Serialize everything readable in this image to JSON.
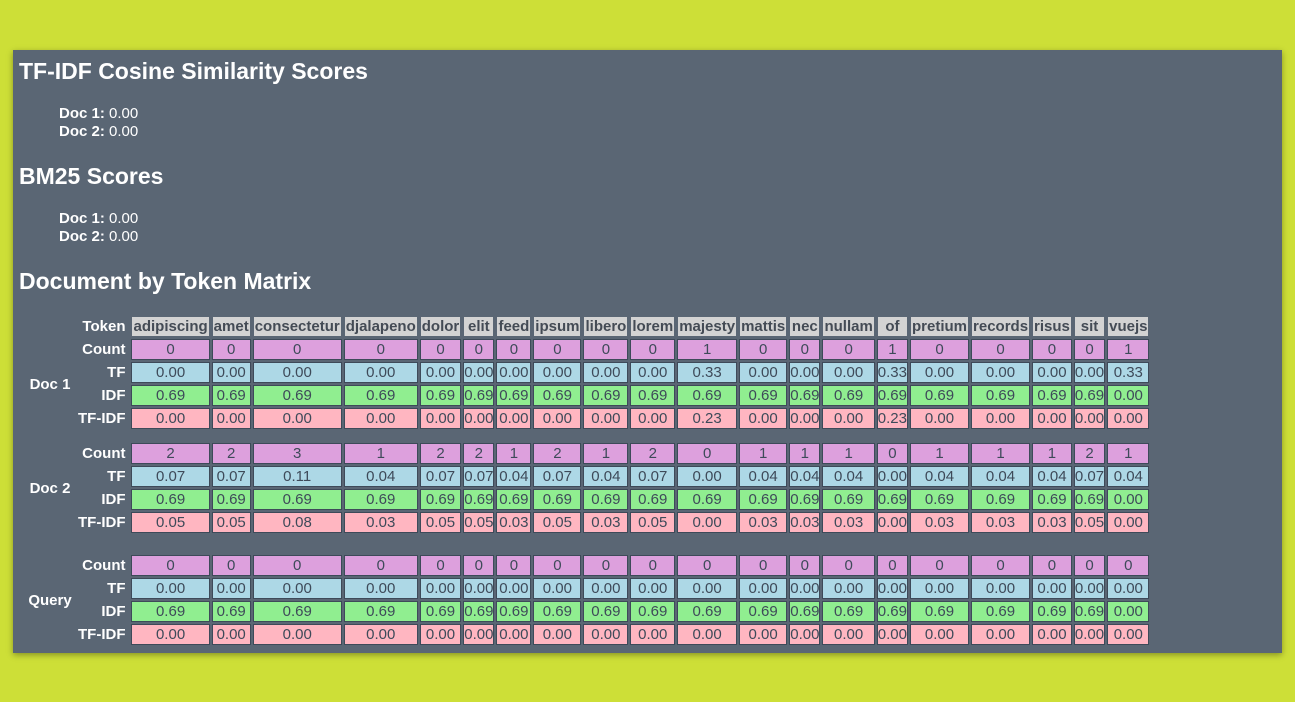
{
  "titles": {
    "cosine": "TF-IDF Cosine Similarity Scores",
    "bm25": "BM25 Scores",
    "matrix": "Document by Token Matrix"
  },
  "cosine_scores": [
    {
      "label": "Doc 1:",
      "value": "0.00"
    },
    {
      "label": "Doc 2:",
      "value": "0.00"
    }
  ],
  "bm25_scores": [
    {
      "label": "Doc 1:",
      "value": "0.00"
    },
    {
      "label": "Doc 2:",
      "value": "0.00"
    }
  ],
  "token_label": "Token",
  "tokens": [
    "adipiscing",
    "amet",
    "consectetur",
    "djalapeno",
    "dolor",
    "elit",
    "feed",
    "ipsum",
    "libero",
    "lorem",
    "majesty",
    "mattis",
    "nec",
    "nullam",
    "of",
    "pretium",
    "records",
    "risus",
    "sit",
    "vuejs"
  ],
  "row_labels": {
    "count": "Count",
    "tf": "TF",
    "idf": "IDF",
    "tfidf": "TF-IDF"
  },
  "colors": {
    "count": "#dda0dd",
    "tf": "#add8e6",
    "idf": "#90ee90",
    "tfidf": "#ffb6c1",
    "panel": "#5a6674",
    "background": "#cddf37"
  },
  "groups": [
    {
      "label": "Doc 1",
      "count": [
        "0",
        "0",
        "0",
        "0",
        "0",
        "0",
        "0",
        "0",
        "0",
        "0",
        "1",
        "0",
        "0",
        "0",
        "1",
        "0",
        "0",
        "0",
        "0",
        "1"
      ],
      "tf": [
        "0.00",
        "0.00",
        "0.00",
        "0.00",
        "0.00",
        "0.00",
        "0.00",
        "0.00",
        "0.00",
        "0.00",
        "0.33",
        "0.00",
        "0.00",
        "0.00",
        "0.33",
        "0.00",
        "0.00",
        "0.00",
        "0.00",
        "0.33"
      ],
      "idf": [
        "0.69",
        "0.69",
        "0.69",
        "0.69",
        "0.69",
        "0.69",
        "0.69",
        "0.69",
        "0.69",
        "0.69",
        "0.69",
        "0.69",
        "0.69",
        "0.69",
        "0.69",
        "0.69",
        "0.69",
        "0.69",
        "0.69",
        "0.00"
      ],
      "tfidf": [
        "0.00",
        "0.00",
        "0.00",
        "0.00",
        "0.00",
        "0.00",
        "0.00",
        "0.00",
        "0.00",
        "0.00",
        "0.23",
        "0.00",
        "0.00",
        "0.00",
        "0.23",
        "0.00",
        "0.00",
        "0.00",
        "0.00",
        "0.00"
      ]
    },
    {
      "label": "Doc 2",
      "count": [
        "2",
        "2",
        "3",
        "1",
        "2",
        "2",
        "1",
        "2",
        "1",
        "2",
        "0",
        "1",
        "1",
        "1",
        "0",
        "1",
        "1",
        "1",
        "2",
        "1"
      ],
      "tf": [
        "0.07",
        "0.07",
        "0.11",
        "0.04",
        "0.07",
        "0.07",
        "0.04",
        "0.07",
        "0.04",
        "0.07",
        "0.00",
        "0.04",
        "0.04",
        "0.04",
        "0.00",
        "0.04",
        "0.04",
        "0.04",
        "0.07",
        "0.04"
      ],
      "idf": [
        "0.69",
        "0.69",
        "0.69",
        "0.69",
        "0.69",
        "0.69",
        "0.69",
        "0.69",
        "0.69",
        "0.69",
        "0.69",
        "0.69",
        "0.69",
        "0.69",
        "0.69",
        "0.69",
        "0.69",
        "0.69",
        "0.69",
        "0.00"
      ],
      "tfidf": [
        "0.05",
        "0.05",
        "0.08",
        "0.03",
        "0.05",
        "0.05",
        "0.03",
        "0.05",
        "0.03",
        "0.05",
        "0.00",
        "0.03",
        "0.03",
        "0.03",
        "0.00",
        "0.03",
        "0.03",
        "0.03",
        "0.05",
        "0.00"
      ]
    },
    {
      "label": "Query",
      "count": [
        "0",
        "0",
        "0",
        "0",
        "0",
        "0",
        "0",
        "0",
        "0",
        "0",
        "0",
        "0",
        "0",
        "0",
        "0",
        "0",
        "0",
        "0",
        "0",
        "0"
      ],
      "tf": [
        "0.00",
        "0.00",
        "0.00",
        "0.00",
        "0.00",
        "0.00",
        "0.00",
        "0.00",
        "0.00",
        "0.00",
        "0.00",
        "0.00",
        "0.00",
        "0.00",
        "0.00",
        "0.00",
        "0.00",
        "0.00",
        "0.00",
        "0.00"
      ],
      "idf": [
        "0.69",
        "0.69",
        "0.69",
        "0.69",
        "0.69",
        "0.69",
        "0.69",
        "0.69",
        "0.69",
        "0.69",
        "0.69",
        "0.69",
        "0.69",
        "0.69",
        "0.69",
        "0.69",
        "0.69",
        "0.69",
        "0.69",
        "0.00"
      ],
      "tfidf": [
        "0.00",
        "0.00",
        "0.00",
        "0.00",
        "0.00",
        "0.00",
        "0.00",
        "0.00",
        "0.00",
        "0.00",
        "0.00",
        "0.00",
        "0.00",
        "0.00",
        "0.00",
        "0.00",
        "0.00",
        "0.00",
        "0.00",
        "0.00"
      ]
    }
  ]
}
